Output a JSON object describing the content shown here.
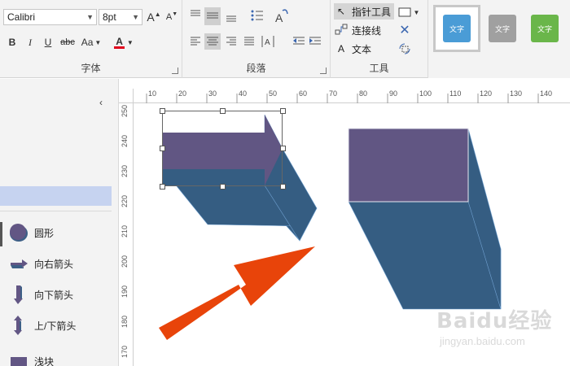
{
  "ribbon": {
    "font_group": {
      "label": "字体",
      "font_name": "Calibri",
      "font_size": "8pt",
      "grow_font": "A",
      "shrink_font": "A",
      "bold": "B",
      "italic": "I",
      "underline": "U",
      "strikethrough": "abc",
      "change_case": "Aa",
      "font_color": "A",
      "font_color_hex": "#e0001b"
    },
    "paragraph_group": {
      "label": "段落"
    },
    "tools_group": {
      "label": "工具",
      "pointer_tool": "指针工具",
      "connector": "连接线",
      "text": "文本",
      "text_icon": "A"
    },
    "styles": {
      "items": [
        {
          "label": "文字",
          "color": "#4a9cd6"
        },
        {
          "label": "文字",
          "color": "#a0a0a0"
        },
        {
          "label": "文字",
          "color": "#6ab64a"
        }
      ]
    }
  },
  "panel": {
    "shapes": [
      {
        "label": "圆形",
        "icon": "circle-icon"
      },
      {
        "label": "向右箭头",
        "icon": "right-arrow-icon"
      },
      {
        "label": "向下箭头",
        "icon": "down-arrow-icon"
      },
      {
        "label": "上/下箭头",
        "icon": "up-down-arrow-icon"
      },
      {
        "label": "浅块",
        "icon": "shallow-block-icon"
      }
    ]
  },
  "ruler": {
    "top": [
      "10",
      "20",
      "30",
      "40",
      "50",
      "60",
      "70",
      "80",
      "90",
      "100",
      "110",
      "120",
      "130",
      "140"
    ],
    "left": [
      "250",
      "240",
      "230",
      "220",
      "210",
      "200",
      "190",
      "180",
      "170"
    ]
  },
  "watermark": {
    "text": "Baidu经验",
    "url": "jingyan.baidu.com"
  },
  "colors": {
    "shape_front": "#615683",
    "shape_side": "#355d82",
    "arrow_orange": "#e8440a"
  }
}
